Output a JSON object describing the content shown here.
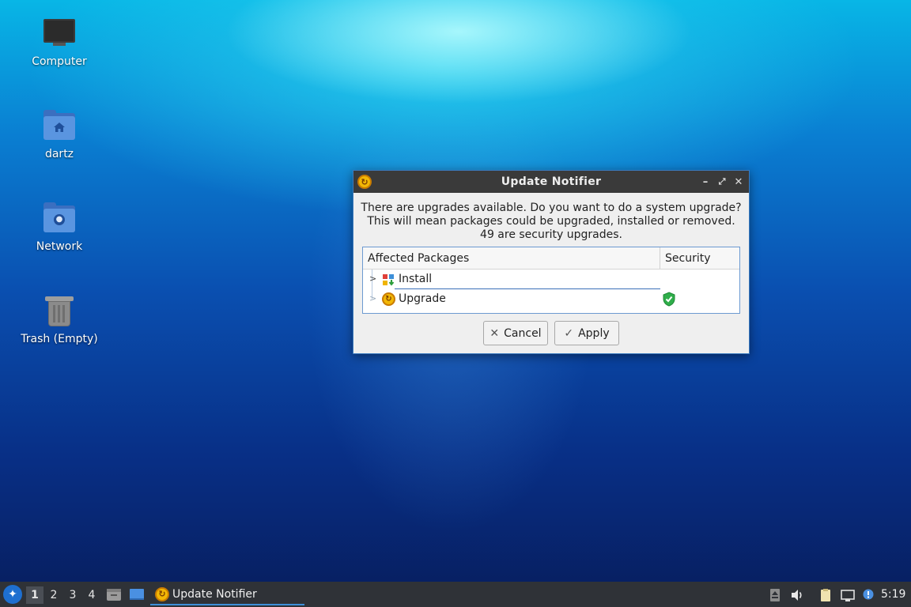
{
  "desktop": {
    "icons": [
      {
        "label": "Computer",
        "icon": "computer-icon"
      },
      {
        "label": "dartz",
        "icon": "home-folder-icon"
      },
      {
        "label": "Network",
        "icon": "network-folder-icon"
      },
      {
        "label": "Trash (Empty)",
        "icon": "trash-icon"
      }
    ]
  },
  "dialog": {
    "title": "Update Notifier",
    "message": [
      "There are upgrades available. Do you want to do a system upgrade?",
      "This will mean packages could be upgraded, installed or removed.",
      "49 are security upgrades."
    ],
    "columns": {
      "packages": "Affected Packages",
      "security": "Security"
    },
    "rows": [
      {
        "label": "Install",
        "icon": "install-icon",
        "security": false
      },
      {
        "label": "Upgrade",
        "icon": "upgrade-icon",
        "security": true
      }
    ],
    "buttons": {
      "cancel": "Cancel",
      "apply": "Apply"
    }
  },
  "taskbar": {
    "workspaces": [
      "1",
      "2",
      "3",
      "4"
    ],
    "active_workspace": "1",
    "task": "Update Notifier",
    "clock": "5:19"
  },
  "colors": {
    "accent": "#3d8fd8",
    "titlebar": "#3a3a3a",
    "taskbar": "#2f3237"
  }
}
